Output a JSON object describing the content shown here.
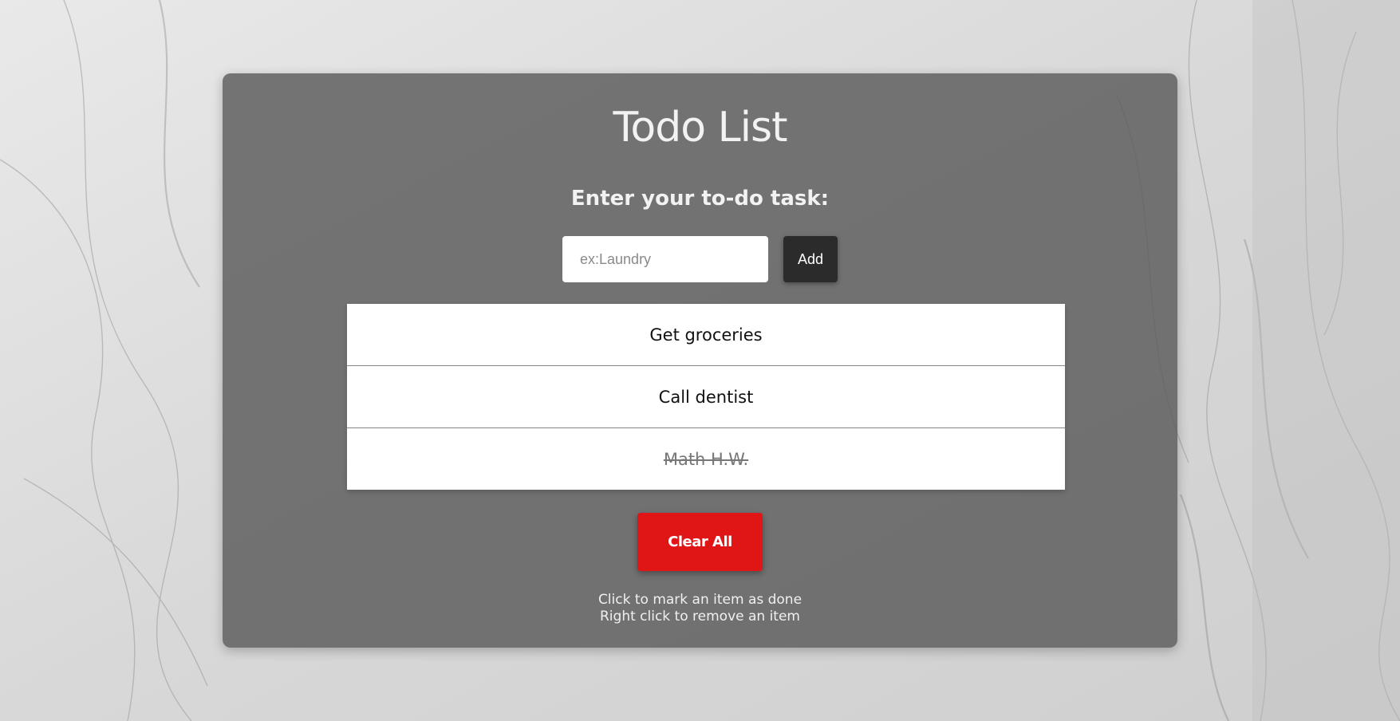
{
  "app": {
    "title": "Todo List",
    "prompt": "Enter your to-do task:"
  },
  "input": {
    "placeholder": "ex:Laundry",
    "value": ""
  },
  "add_button": {
    "label": "Add"
  },
  "todos": [
    {
      "text": "Get groceries",
      "done": false
    },
    {
      "text": "Call dentist",
      "done": false
    },
    {
      "text": "Math H.W.",
      "done": true
    }
  ],
  "clear_button": {
    "label": "Clear All",
    "color": "#e01616"
  },
  "hints": {
    "line1": "Click to mark an item as done",
    "line2": "Right click to remove an item"
  },
  "colors": {
    "panel": "#5a5a5a",
    "add_button": "#2b2b2b"
  }
}
